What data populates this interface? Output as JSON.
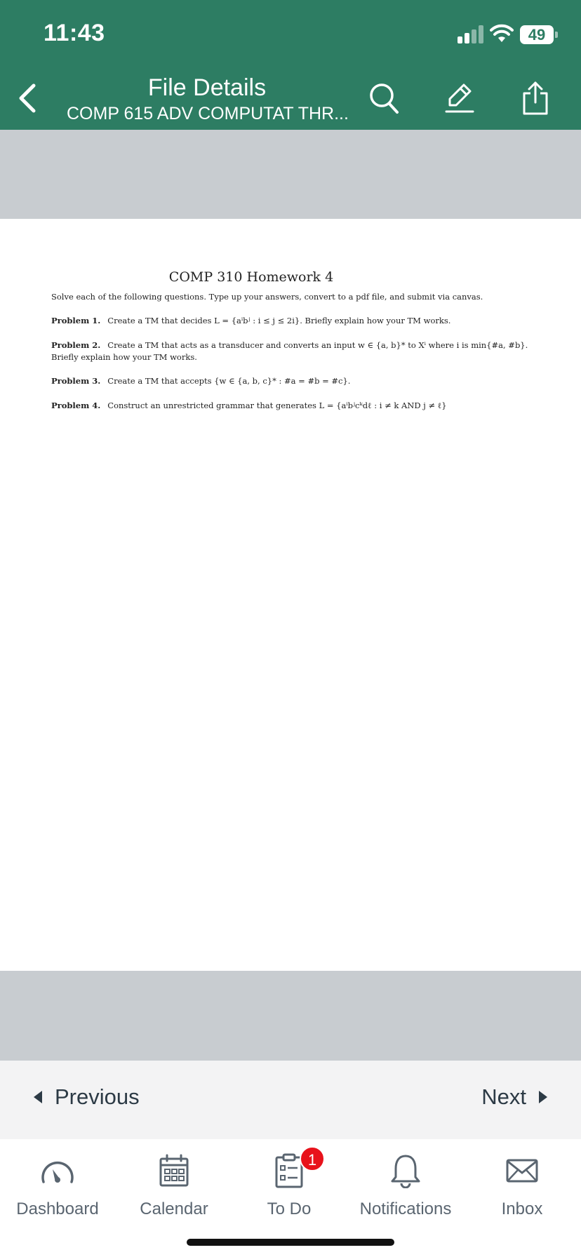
{
  "status": {
    "time": "11:43",
    "battery": "49"
  },
  "header": {
    "title": "File Details",
    "subtitle": "COMP 615 ADV COMPUTAT THR...",
    "bg_color": "#2d7d63"
  },
  "document": {
    "title": "COMP 310 Homework 4",
    "intro": "Solve each of the following questions. Type up your answers, convert to a pdf file, and submit via canvas.",
    "problems": [
      {
        "label": "Problem 1.",
        "text": "Create a TM that decides L = {aⁱbʲ : i ≤ j ≤ 2i}. Briefly explain how your TM works."
      },
      {
        "label": "Problem 2.",
        "text": "Create a TM that acts as a transducer and converts an input w ∈ {a, b}* to Xⁱ where i is min{#a, #b}.",
        "text2": "Briefly explain how your TM works."
      },
      {
        "label": "Problem 3.",
        "text": "Create a TM that accepts {w ∈ {a, b, c}* : #a = #b = #c}."
      },
      {
        "label": "Problem 4.",
        "text": "Construct an unrestricted grammar that generates L = {aⁱbʲcᵏdℓ : i ≠ k AND j ≠ ℓ}"
      }
    ]
  },
  "pager": {
    "previous": "Previous",
    "next": "Next"
  },
  "tabs": [
    {
      "label": "Dashboard",
      "icon": "dashboard-icon"
    },
    {
      "label": "Calendar",
      "icon": "calendar-icon"
    },
    {
      "label": "To Do",
      "icon": "todo-icon",
      "badge": "1"
    },
    {
      "label": "Notifications",
      "icon": "bell-icon"
    },
    {
      "label": "Inbox",
      "icon": "inbox-icon"
    }
  ]
}
